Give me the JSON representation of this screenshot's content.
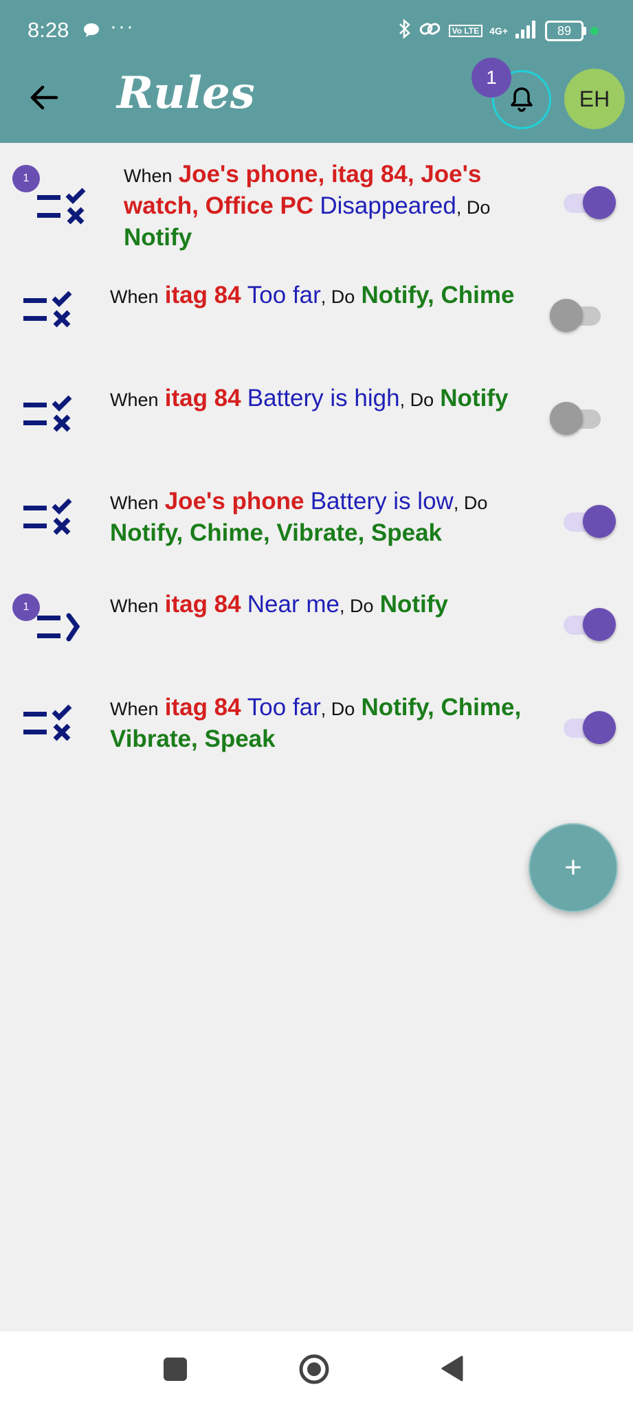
{
  "status_bar": {
    "time": "8:28",
    "net_top": "4G+",
    "volte": "Vo LTE",
    "battery": "89"
  },
  "header": {
    "title": "Rules",
    "notification_count": "1",
    "avatar_initials": "EH"
  },
  "rules": [
    {
      "badge": "1",
      "icon": "rule-check-icon",
      "when": "When",
      "devices": "Joe's phone, itag 84, Joe's watch, Office PC",
      "condition": "Disappeared",
      "do": ", Do",
      "actions": "Notify",
      "enabled": true
    },
    {
      "icon": "rule-check-icon",
      "when": "When",
      "devices": "itag 84",
      "condition": "Too far",
      "do": ", Do",
      "actions": "Notify, Chime",
      "enabled": false
    },
    {
      "icon": "rule-check-icon",
      "when": "When",
      "devices": "itag 84",
      "condition": "Battery is high",
      "do": ", Do",
      "actions": "Notify",
      "enabled": false
    },
    {
      "icon": "rule-check-icon",
      "when": "When",
      "devices": "Joe's phone",
      "condition": "Battery is low",
      "do": ", Do",
      "actions": "Notify, Chime, Vibrate, Speak",
      "enabled": true
    },
    {
      "badge": "1",
      "icon": "rule-arrow-icon",
      "when": "When",
      "devices": "itag 84",
      "condition": "Near me",
      "do": ", Do",
      "actions": "Notify",
      "enabled": true
    },
    {
      "icon": "rule-check-icon",
      "when": "When",
      "devices": "itag 84",
      "condition": "Too far",
      "do": ", Do",
      "actions": "Notify, Chime, Vibrate, Speak",
      "enabled": true
    }
  ],
  "fab": {
    "label": "+"
  },
  "colors": {
    "appbar": "#5e9d9f",
    "device": "#d61f1f",
    "condition": "#1f1fb8",
    "action": "#1a7d1a",
    "accent": "#6a4fb3",
    "avatar": "#9ccb62"
  }
}
